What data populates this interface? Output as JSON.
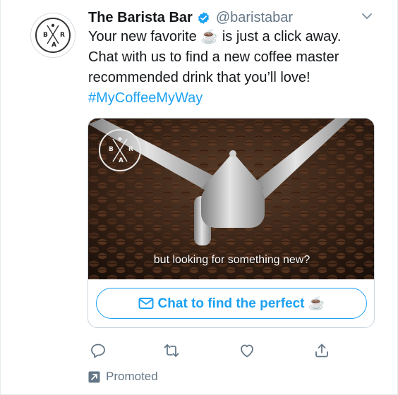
{
  "tweet": {
    "author_name": "The Barista Bar",
    "handle": "@baristabar",
    "text_line1": "Your new favorite ☕ is just a click away.",
    "text_line2": "Chat with us to find a new coffee master",
    "text_line3": "recommended drink that you’ll love!",
    "hashtag": "#MyCoffeeMyWay"
  },
  "logo": {
    "letter_b": "B",
    "letter_r": "R",
    "letter_a": "A"
  },
  "card": {
    "caption": "but looking for something new?",
    "cta_label": "Chat to find the perfect ☕"
  },
  "footer": {
    "promoted_label": "Promoted"
  },
  "icons": {
    "verified": "verified-badge-icon",
    "chevron": "chevron-down-icon",
    "reply": "reply-icon",
    "retweet": "retweet-icon",
    "like": "heart-icon",
    "share": "share-icon",
    "promoted": "promoted-arrow-icon",
    "message": "envelope-icon"
  },
  "colors": {
    "accent": "#1da1f2",
    "text": "#14171a",
    "secondary": "#657786"
  }
}
